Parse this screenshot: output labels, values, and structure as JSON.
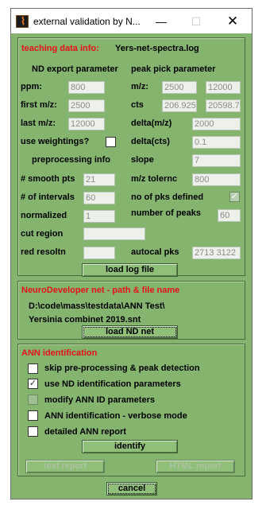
{
  "window": {
    "title": "external validation by N...",
    "minimize_glyph": "—",
    "maximize_glyph": "☐",
    "close_glyph": "✕"
  },
  "teaching": {
    "heading": "teaching data info:",
    "file": "Yers-net-spectra.log",
    "nd_export_header": "ND export parameter",
    "peak_pick_header": "peak pick parameter",
    "ppm_label": "ppm:",
    "ppm_value": "800",
    "first_mz_label": "first m/z:",
    "first_mz_value": "2500",
    "last_mz_label": "last m/z:",
    "last_mz_value": "12000",
    "use_weightings_label": "use weightings?",
    "preprocessing_info_label": "preprocessing info",
    "smooth_pts_label": "# smooth pts",
    "smooth_pts_value": "21",
    "intervals_label": "# of intervals",
    "intervals_value": "60",
    "normalized_label": "normalized",
    "normalized_value": "1",
    "cut_region_label": "cut region",
    "cut_region_value": "",
    "red_resoltn_label": "red resoltn",
    "red_resoltn_value": "",
    "mz_label": "m/z:",
    "mz_value1": "2500",
    "mz_value2": "12000",
    "cts_label": "cts",
    "cts_value1": "206.925",
    "cts_value2": "20598.73",
    "delta_mz_label": "delta(m/z)",
    "delta_mz_value": "2000",
    "delta_cts_label": "delta(cts)",
    "delta_cts_value": "0.1",
    "slope_label": "slope",
    "slope_value": "7",
    "mz_tolernc_label": "m/z tolernc",
    "mz_tolernc_value": "800",
    "no_pks_defined_label": "no of pks defined",
    "no_pks_defined_check": "✓",
    "number_of_peaks_label": "number of peaks",
    "number_of_peaks_value": "60",
    "autocal_pks_label": "autocal pks",
    "autocal_pks_value": "2713  3122",
    "load_log_label": "load log file"
  },
  "neuro": {
    "heading": "NeuroDeveloper net - path & file name",
    "path": "D:\\code\\mass\\testdata\\ANN Test\\",
    "file": "Yersinia combinet 2019.snt",
    "load_nd_label": "load ND net"
  },
  "ann": {
    "heading": "ANN identification",
    "options": [
      {
        "label": "skip pre-processing & peak detection",
        "checked": ""
      },
      {
        "label": "use ND identification parameters",
        "checked": "✓"
      },
      {
        "label": "modify ANN ID parameters",
        "checked": ""
      },
      {
        "label": "ANN identification - verbose mode",
        "checked": ""
      },
      {
        "label": "detailed ANN report",
        "checked": ""
      }
    ],
    "identify_label": "identify",
    "text_report_label": "text report",
    "html_report_label": "HTML report"
  },
  "cancel_label": "cancel",
  "colors": {
    "background": "#84b46e",
    "heading_red": "#e8101a"
  }
}
